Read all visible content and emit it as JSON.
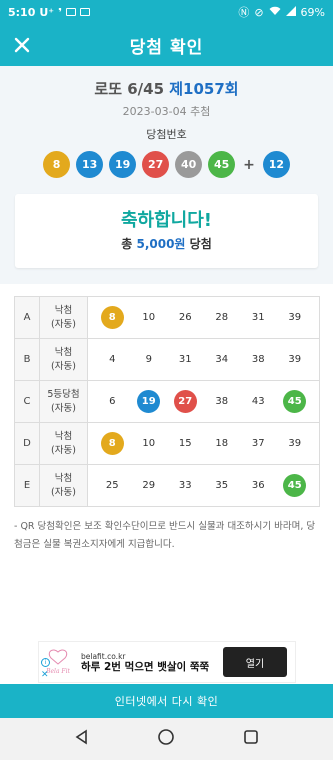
{
  "status_bar": {
    "time": "5:10",
    "carrier": "U⁺",
    "battery": "69%"
  },
  "header": {
    "title": "당첨 확인"
  },
  "result": {
    "game": "로또 6/45",
    "round": "제1057회",
    "date": "2023-03-04 추첨",
    "label": "당첨번호",
    "numbers": [
      "8",
      "13",
      "19",
      "27",
      "40",
      "45"
    ],
    "plus": "+",
    "bonus": "12",
    "colors": {
      "8": "#e3a91d",
      "13": "#1f8ad1",
      "19": "#1f8ad1",
      "27": "#e0504a",
      "40": "#9a9a9a",
      "45": "#4cb648",
      "12": "#1f8ad1"
    }
  },
  "congrats": {
    "message": "축하합니다!",
    "prize_prefix": "총",
    "prize_amount": "5,000원",
    "prize_suffix": "당첨"
  },
  "tickets": [
    {
      "label": "A",
      "result": [
        "낙첨",
        "(자동)"
      ],
      "numbers": [
        "8",
        "10",
        "26",
        "28",
        "31",
        "39"
      ],
      "matched": [
        "8"
      ]
    },
    {
      "label": "B",
      "result": [
        "낙첨",
        "(자동)"
      ],
      "numbers": [
        "4",
        "9",
        "31",
        "34",
        "38",
        "39"
      ],
      "matched": []
    },
    {
      "label": "C",
      "result": [
        "5등당첨",
        "(자동)"
      ],
      "numbers": [
        "6",
        "19",
        "27",
        "38",
        "43",
        "45"
      ],
      "matched": [
        "19",
        "27",
        "45"
      ]
    },
    {
      "label": "D",
      "result": [
        "낙첨",
        "(자동)"
      ],
      "numbers": [
        "8",
        "10",
        "15",
        "18",
        "37",
        "39"
      ],
      "matched": [
        "8"
      ]
    },
    {
      "label": "E",
      "result": [
        "낙첨",
        "(자동)"
      ],
      "numbers": [
        "25",
        "29",
        "33",
        "35",
        "36",
        "45"
      ],
      "matched": [
        "45"
      ]
    }
  ],
  "notice": "- QR 당첨확인은 보조 확인수단이므로 반드시 실물과 대조하시기 바라며, 당첨금은 실물 복권소지자에게 지급합니다.",
  "ad": {
    "logo": "Bella Fit",
    "domain": "belafit.co.kr",
    "headline": "하루 2번 먹으면 뱃살이 쭉쭉",
    "button": "열기"
  },
  "recheck_button": "인터넷에서 다시 확인"
}
